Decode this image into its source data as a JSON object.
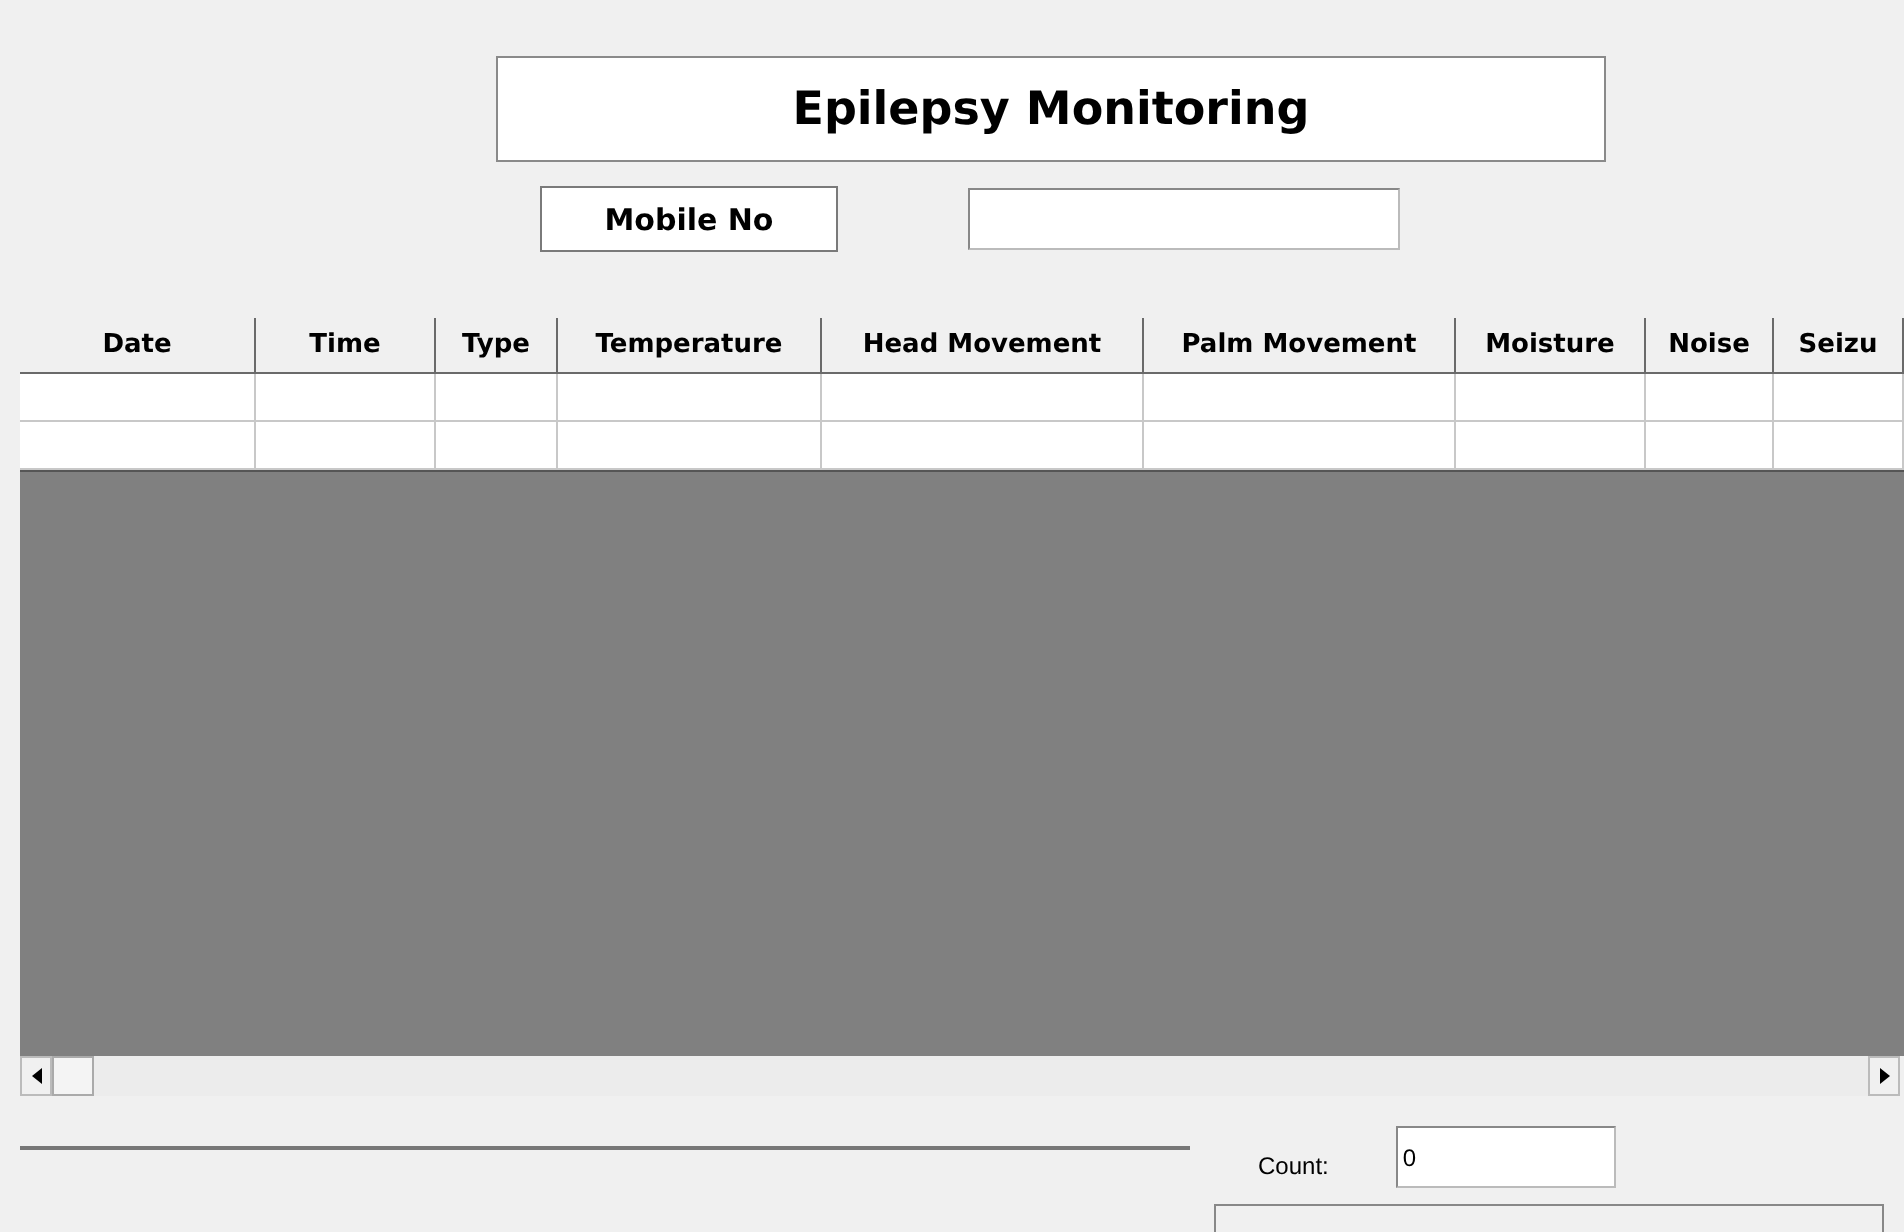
{
  "title": "Epilepsy Monitoring",
  "mobile": {
    "label": "Mobile No"
  },
  "table": {
    "columns": [
      "Date",
      "Time",
      "Type",
      "Temperature",
      "Head Movement",
      "Palm Movement",
      "Moisture",
      "Noise",
      "Seizu"
    ]
  },
  "count": {
    "label": "Count:",
    "value": "0"
  }
}
